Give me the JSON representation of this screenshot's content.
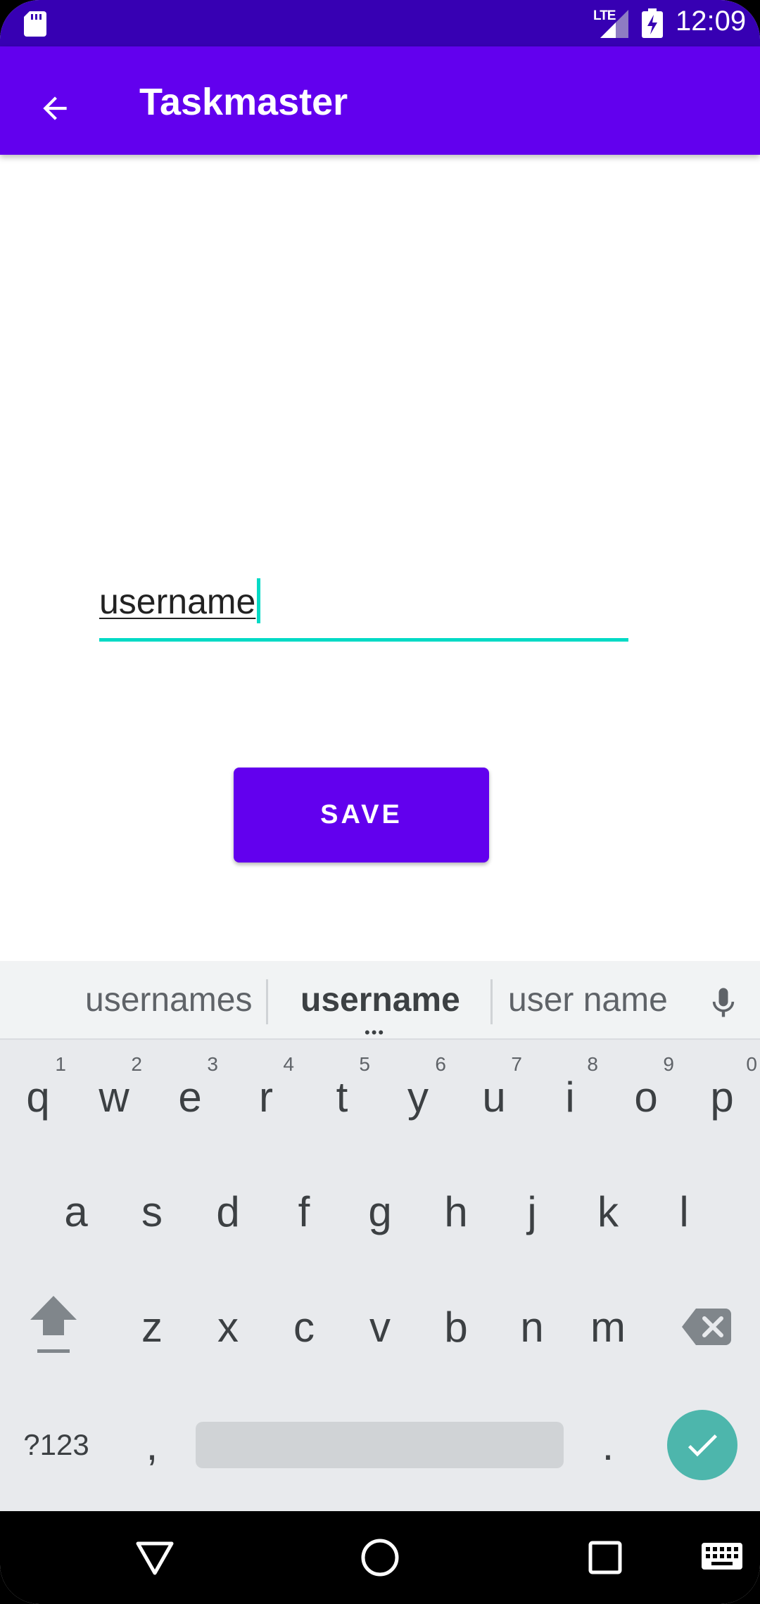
{
  "status_bar": {
    "network": "LTE",
    "time": "12:09"
  },
  "app_bar": {
    "title": "Taskmaster"
  },
  "form": {
    "username_value": "username",
    "save_label": "SAVE"
  },
  "keyboard": {
    "suggestions": [
      "usernames",
      "username",
      "user name"
    ],
    "row1": [
      {
        "key": "q",
        "hint": "1"
      },
      {
        "key": "w",
        "hint": "2"
      },
      {
        "key": "e",
        "hint": "3"
      },
      {
        "key": "r",
        "hint": "4"
      },
      {
        "key": "t",
        "hint": "5"
      },
      {
        "key": "y",
        "hint": "6"
      },
      {
        "key": "u",
        "hint": "7"
      },
      {
        "key": "i",
        "hint": "8"
      },
      {
        "key": "o",
        "hint": "9"
      },
      {
        "key": "p",
        "hint": "0"
      }
    ],
    "row2": [
      "a",
      "s",
      "d",
      "f",
      "g",
      "h",
      "j",
      "k",
      "l"
    ],
    "row3": [
      "z",
      "x",
      "c",
      "v",
      "b",
      "n",
      "m"
    ],
    "symbols_label": "?123",
    "comma": ",",
    "period": "."
  },
  "colors": {
    "status_bar": "#3700B3",
    "primary": "#6200EE",
    "accent": "#03DAC5",
    "enter_key": "#4DB6AC"
  }
}
